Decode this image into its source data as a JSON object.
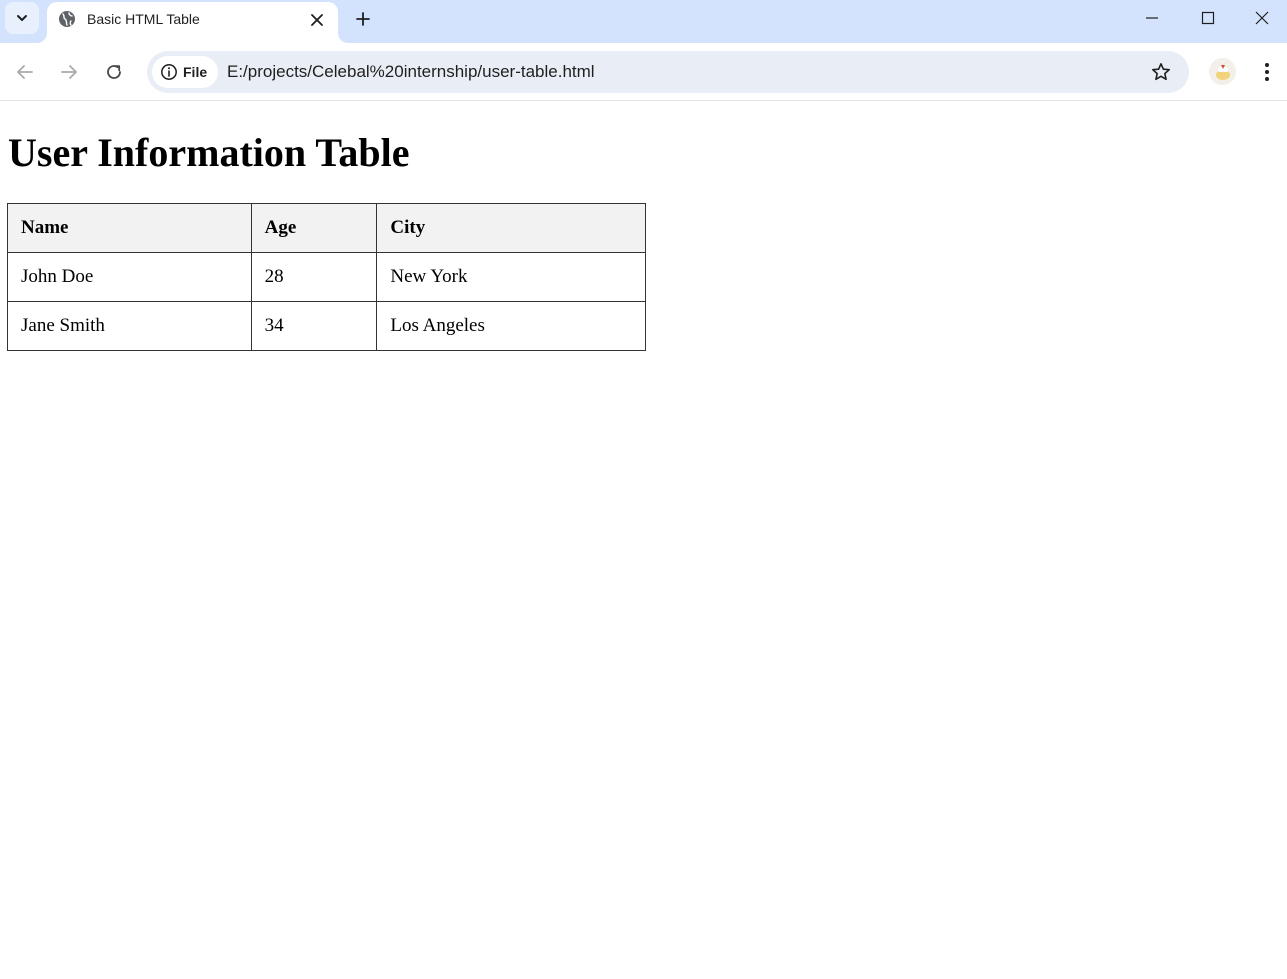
{
  "browser": {
    "tab": {
      "title": "Basic HTML Table"
    },
    "address_bar": {
      "site_chip": "File",
      "url": "E:/projects/Celebal%20internship/user-table.html"
    },
    "icons": {
      "tab_search": "chevron-down-icon",
      "favicon": "globe-icon",
      "tab_close": "close-icon",
      "new_tab": "plus-icon",
      "minimize": "minimize-icon",
      "maximize": "maximize-icon",
      "close_window": "close-icon",
      "back": "arrow-left-icon",
      "forward": "arrow-right-icon",
      "reload": "reload-icon",
      "site_info": "info-icon",
      "bookmark": "star-icon",
      "profile": "avatar",
      "menu": "kebab-menu-icon"
    },
    "colors": {
      "tabstrip": "#d3e3fd",
      "omnibox": "#e9eef6",
      "table_header_bg": "#f2f2f2"
    }
  },
  "page": {
    "title": "User Information Table",
    "table": {
      "headers": [
        "Name",
        "Age",
        "City"
      ],
      "rows": [
        [
          "John Doe",
          "28",
          "New York"
        ],
        [
          "Jane Smith",
          "34",
          "Los Angeles"
        ]
      ]
    }
  }
}
